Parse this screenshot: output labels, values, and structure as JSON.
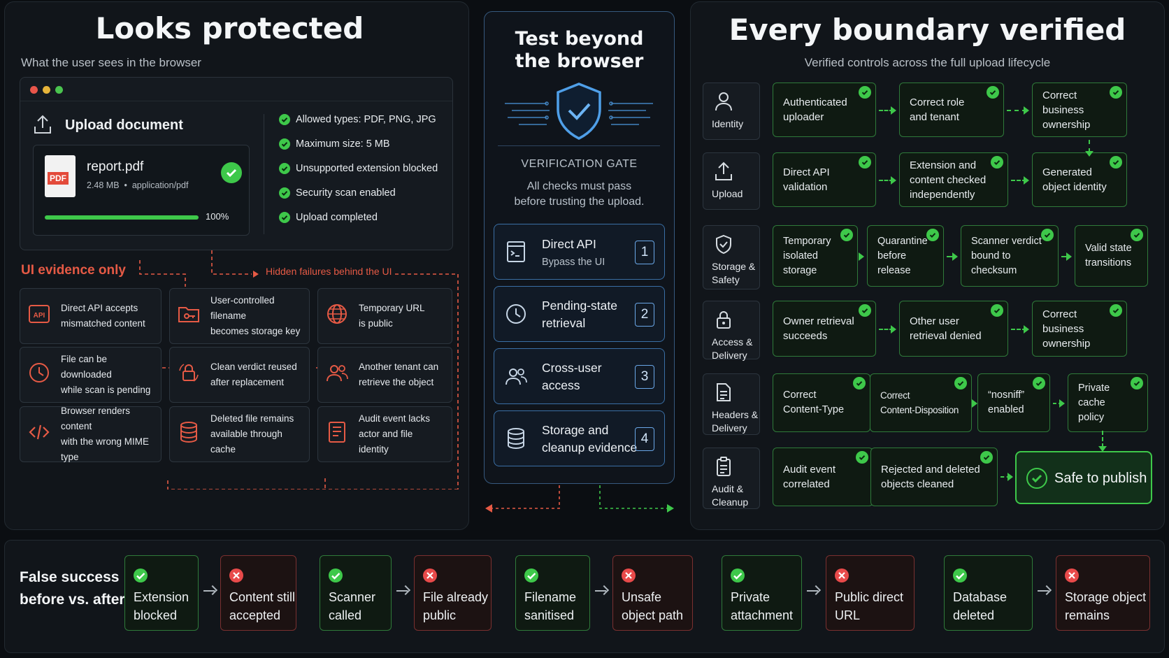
{
  "left": {
    "title": "Looks protected",
    "subtitle": "What the user sees in the browser",
    "upload_title": "Upload document",
    "file_name": "report.pdf",
    "file_meta": "2.48 MB  •  application/pdf",
    "file_badge": "PDF",
    "progress_value": 1.0,
    "progress_label": "100%",
    "checks": [
      "Allowed types: PDF, PNG, JPG",
      "Maximum size: 5 MB",
      "Unsupported extension blocked",
      "Security scan enabled",
      "Upload completed"
    ],
    "ui_evidence_label": "UI evidence only",
    "hidden_failures_label": "Hidden failures behind the UI",
    "evidence": [
      {
        "icon": "api-icon",
        "text": [
          "Direct API accepts",
          "mismatched content"
        ]
      },
      {
        "icon": "folder-key-icon",
        "text": [
          "User-controlled filename",
          "becomes storage key"
        ]
      },
      {
        "icon": "globe-icon",
        "text": [
          "Temporary URL",
          "is public"
        ]
      },
      {
        "icon": "clock-icon",
        "text": [
          "File can be downloaded",
          "while scan is pending"
        ]
      },
      {
        "icon": "lock-refresh-icon",
        "text": [
          "Clean verdict reused",
          "after replacement"
        ]
      },
      {
        "icon": "users-icon",
        "text": [
          "Another tenant can",
          "retrieve the object"
        ]
      },
      {
        "icon": "code-icon",
        "text": [
          "Browser renders content",
          "with the wrong MIME type"
        ]
      },
      {
        "icon": "database-icon",
        "text": [
          "Deleted file remains",
          "available through cache"
        ]
      },
      {
        "icon": "document-list-icon",
        "text": [
          "Audit event lacks",
          "actor and file identity"
        ]
      }
    ]
  },
  "center": {
    "title": [
      "Test beyond",
      "the browser"
    ],
    "gate_label": "VERIFICATION GATE",
    "gate_text": [
      "All checks must pass",
      "before trusting the upload."
    ],
    "items": [
      {
        "icon": "terminal-icon",
        "title": "Direct API",
        "subtitle": "Bypass the UI",
        "num": "1"
      },
      {
        "icon": "clock-icon",
        "title": "Pending-state",
        "subtitle": "retrieval",
        "num": "2"
      },
      {
        "icon": "users-icon",
        "title": "Cross-user",
        "subtitle": "access",
        "num": "3"
      },
      {
        "icon": "database-icon",
        "title": "Storage and",
        "subtitle": "cleanup evidence",
        "num": "4"
      }
    ]
  },
  "right": {
    "title": "Every boundary verified",
    "subtitle": "Verified controls across the full upload lifecycle",
    "stages": [
      {
        "label": [
          "Identity"
        ],
        "icon": "person-icon",
        "steps": [
          [
            "Authenticated",
            "uploader"
          ],
          [
            "Correct role",
            "and tenant"
          ],
          [
            "Correct business",
            "ownership"
          ]
        ]
      },
      {
        "label": [
          "Upload"
        ],
        "icon": "upload-icon",
        "steps": [
          [
            "Direct API",
            "validation"
          ],
          [
            "Extension and",
            "content checked",
            "independently"
          ],
          [
            "Generated",
            "object identity"
          ]
        ]
      },
      {
        "label": [
          "Storage &",
          "Safety"
        ],
        "icon": "shield-icon",
        "steps": [
          [
            "Temporary",
            "isolated storage"
          ],
          [
            "Quarantine",
            "before release"
          ],
          [
            "Scanner verdict",
            "bound to checksum"
          ],
          [
            "Valid state",
            "transitions"
          ]
        ]
      },
      {
        "label": [
          "Access &",
          "Delivery"
        ],
        "icon": "lock-icon",
        "steps": [
          [
            "Owner retrieval",
            "succeeds"
          ],
          [
            "Other user",
            "retrieval denied"
          ],
          [
            "Correct business",
            "ownership"
          ]
        ]
      },
      {
        "label": [
          "Headers &",
          "Delivery"
        ],
        "icon": "document-icon",
        "steps": [
          [
            "Correct",
            "Content-Type"
          ],
          [
            "Correct",
            "Content-Disposition"
          ],
          [
            "“nosniff”",
            "enabled"
          ],
          [
            "Private cache",
            "policy"
          ]
        ]
      },
      {
        "label": [
          "Audit &",
          "Cleanup"
        ],
        "icon": "clipboard-icon",
        "steps": [
          [
            "Audit event",
            "correlated"
          ],
          [
            "Rejected and deleted",
            "objects cleaned"
          ]
        ]
      }
    ],
    "final": "Safe to publish"
  },
  "bottom": {
    "label": [
      "False success",
      "before vs. after"
    ],
    "pairs": [
      {
        "ok": [
          "Extension",
          "blocked"
        ],
        "bad": [
          "Content still",
          "accepted"
        ]
      },
      {
        "ok": [
          "Scanner",
          "called"
        ],
        "bad": [
          "File already",
          "public"
        ]
      },
      {
        "ok": [
          "Filename",
          "sanitised"
        ],
        "bad": [
          "Unsafe",
          "object path"
        ]
      },
      {
        "ok": [
          "Private",
          "attachment"
        ],
        "bad": [
          "Public direct",
          "URL"
        ]
      },
      {
        "ok": [
          "Database",
          "deleted"
        ],
        "bad": [
          "Storage object",
          "remains"
        ]
      }
    ]
  },
  "colors": {
    "ok": "#3ec84a",
    "bad": "#e84a4a",
    "accent_blue": "#4f9fe8",
    "warn": "#e65a45"
  }
}
